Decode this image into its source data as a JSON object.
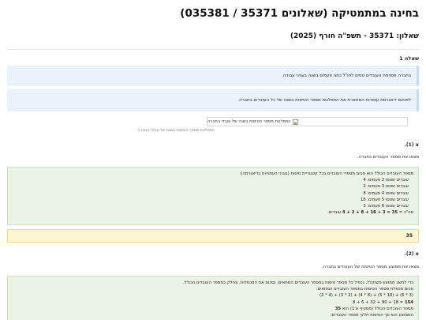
{
  "header": {
    "title": "בחינה במתמטיקה (שאלונים 35371 / 035381)",
    "subtitle": "שאלון: 35371 - תשפ\"ה חורף (2025)"
  },
  "question": {
    "heading": "שאלה 1",
    "intro_1": "בחברה מסוימת העובדים טסים לחו\"ל כמה פעמים בשנה בעניני עבודה.",
    "intro_2": "לפניכם דיאגרמת עמודות המתארת את התפלגות מספר הטיסות בשנה של כל העובדים בחברה.",
    "image_alt": "התפלגות מספר הטיסות בשנה של עובדי החברה",
    "image_caption": "התפלגות מספר הטיסות בשנה של עובדי החברה"
  },
  "part_a1": {
    "label": "א (1).",
    "task": "מצאו את מספר העובדים בחברה.",
    "work": {
      "line_intro": "מספר העובדים הכולל הוא סכום מספרי העובדים בכל קטגוריית טיסות (גובהי העמודות בדיאגרמה):",
      "rows": [
        "עובדים שטסו 2 פעמים: 4",
        "עובדים שטסו 3 פעמים: 2",
        "עובדים שטסו 4 פעמים: 8",
        "עובדים שטסו 5 פעמים: 18",
        "עובדים שטסו 6 פעמים: 3"
      ],
      "total_prefix": "סה\"כ = ",
      "total_expr": "4 + 2 + 8 + 18 + 3 = 35",
      "total_suffix": " עובדים."
    },
    "answer": "35"
  },
  "part_a2": {
    "label": "א (2).",
    "task": "מצאו את ממוצע מספר הטיסות של העובדים בחברה.",
    "work": {
      "line_1": "כדי לחשב ממוצע משוקלל, נכפיל כל מספר טיסות במספר העובדים המתאים, נסכום את המכפלות, ונחלק במספר העובדים הכולל.",
      "line_2": "סכום מכפלת מספר הטיסות במספר העובדים המתאים:",
      "line_3_expr": "(2 * 4) + (3 * 2) + (4 * 8) + (5 * 18) + (6 * 3)",
      "line_4_expr": "8 + 6 + 32 + 90 + 18 = ",
      "line_4_result": "154",
      "line_5_prefix": "מספר העובדים הכולל (מסעיף א'1) הוא ",
      "line_5_value": "35",
      "line_6": "הממוצע הוא סך הטיסות חלקי מספר העובדים:"
    }
  }
}
